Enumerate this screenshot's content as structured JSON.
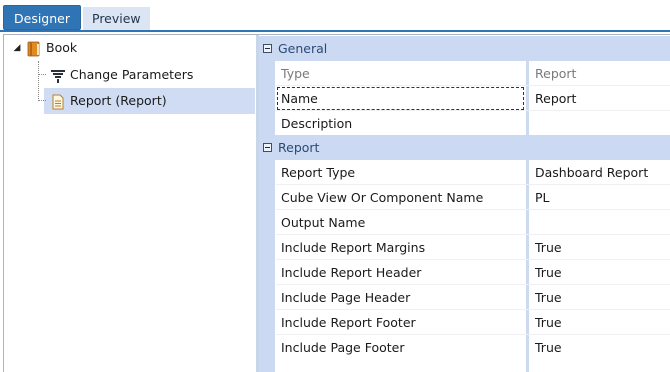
{
  "tabs": {
    "designer": "Designer",
    "preview": "Preview"
  },
  "tree": {
    "root": {
      "label": "Book",
      "icon": "book-icon",
      "color": "#d9822b"
    },
    "children": [
      {
        "label": "Change Parameters",
        "icon": "filter-funnel-icon"
      },
      {
        "label": "Report (Report)",
        "icon": "report-document-icon",
        "selected": true
      }
    ]
  },
  "grid": {
    "categories": [
      {
        "name": "General",
        "properties": [
          {
            "name": "Type",
            "value": "Report",
            "readonly": true
          },
          {
            "name": "Name",
            "value": "Report",
            "focused": true
          },
          {
            "name": "Description",
            "value": ""
          }
        ]
      },
      {
        "name": "Report",
        "properties": [
          {
            "name": "Report Type",
            "value": "Dashboard Report"
          },
          {
            "name": "Cube View Or Component Name",
            "value": "PL"
          },
          {
            "name": "Output Name",
            "value": ""
          },
          {
            "name": "Include Report Margins",
            "value": "True"
          },
          {
            "name": "Include Report Header",
            "value": "True"
          },
          {
            "name": "Include Page Header",
            "value": "True"
          },
          {
            "name": "Include Report Footer",
            "value": "True"
          },
          {
            "name": "Include Page Footer",
            "value": "True"
          }
        ]
      }
    ]
  },
  "colors": {
    "accent": "#2f75b5",
    "category_band": "#ccd9f2",
    "selection": "#cfdcf3"
  }
}
